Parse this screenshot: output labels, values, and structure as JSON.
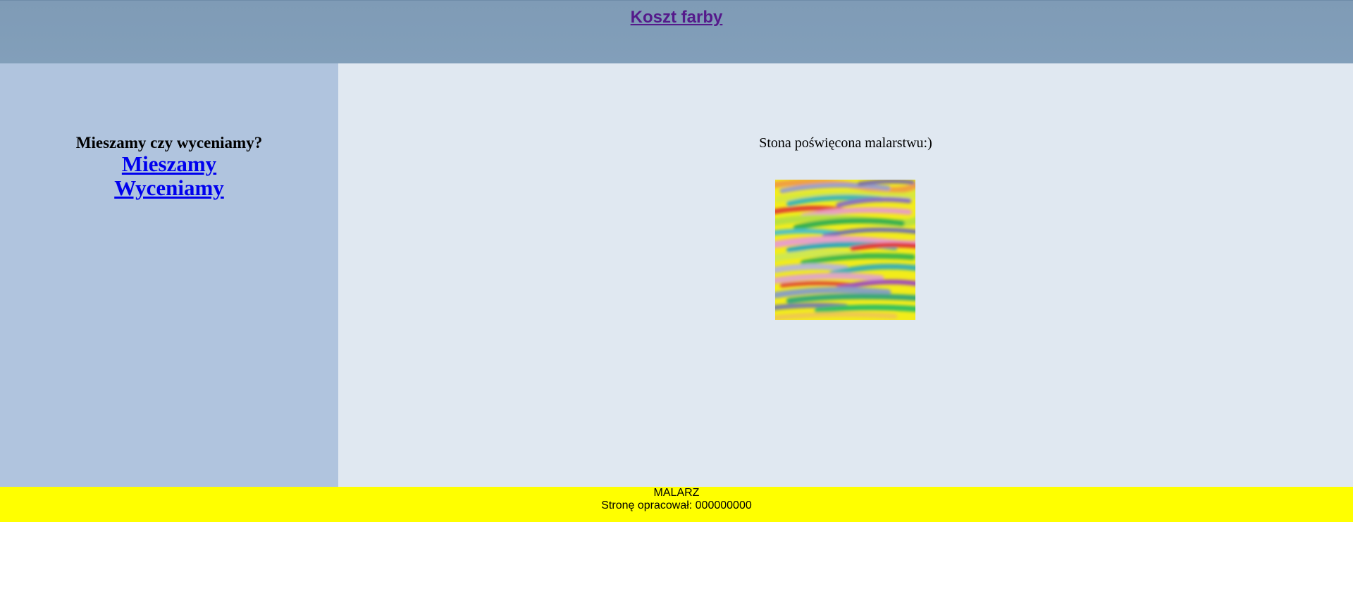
{
  "header": {
    "title_link": "Koszt farby"
  },
  "sidebar": {
    "heading": "Mieszamy czy wyceniamy?",
    "links": [
      {
        "label": "Mieszamy"
      },
      {
        "label": "Wyceniamy"
      }
    ]
  },
  "main": {
    "intro": "Stona poświęcona malarstwu:)",
    "image_icon": "abstract-painting-image"
  },
  "footer": {
    "line1": "MALARZ",
    "line2": "Stronę opracował: 000000000"
  },
  "colors": {
    "header_bg": "#829fba",
    "sidebar_bg": "#b0c4de",
    "main_bg": "#e0e8f1",
    "footer_bg": "#ffff00",
    "link": "#0000ee",
    "visited_link": "#551a8b"
  }
}
